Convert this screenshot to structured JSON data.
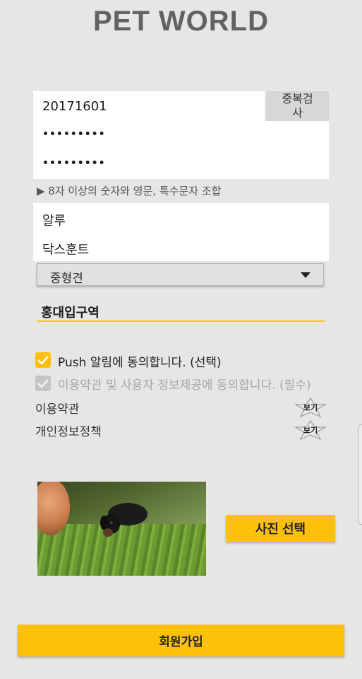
{
  "app": {
    "title": "PET WORLD"
  },
  "form": {
    "user_id": "20171601",
    "dup_check_label": "중복검\n사",
    "password": "•••••••••",
    "password_confirm": "•••••••••",
    "password_hint": "▶ 8자 이상의 숫자와 영문, 특수문자 조합",
    "pet_name": "알루",
    "pet_breed": "닥스훈트",
    "selected_option": "중형견",
    "location": "홍대입구역"
  },
  "checkboxes": {
    "push": {
      "label": "Push 알림에 동의합니다. (선택)",
      "checked": true
    },
    "terms": {
      "label": "이용약관 및 사용자 정보제공에 동의합니다. (필수)",
      "checked": true,
      "disabled": true
    }
  },
  "links": {
    "terms": {
      "label": "이용약관",
      "view_label": "보기"
    },
    "privacy": {
      "label": "개인정보정책",
      "view_label": "보기"
    }
  },
  "photo": {
    "select_label": "사진 선택"
  },
  "submit": {
    "label": "회원가입"
  },
  "colors": {
    "accent": "#ffc107",
    "background": "#e6e6e7",
    "title": "#616263"
  },
  "icons": {
    "dropdown": "chevron-down-icon",
    "checkbox": "check-icon",
    "star": "star-icon"
  }
}
